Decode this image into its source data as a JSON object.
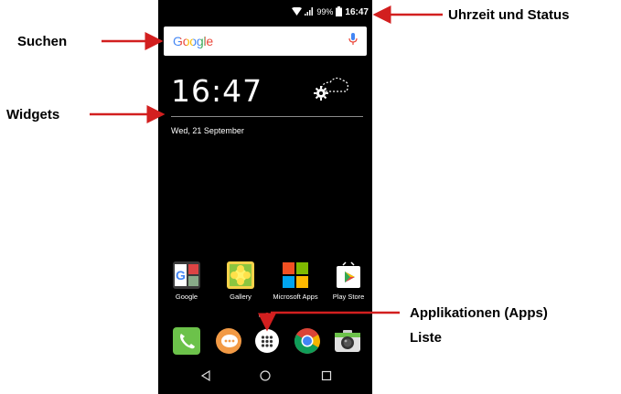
{
  "status": {
    "battery": "99%",
    "time": "16:47"
  },
  "search": {
    "brand": "Google"
  },
  "widget": {
    "clock": "16:47",
    "date": "Wed, 21 September"
  },
  "apps": [
    {
      "label": "Google"
    },
    {
      "label": "Gallery"
    },
    {
      "label": "Microsoft Apps"
    },
    {
      "label": "Play Store"
    }
  ],
  "labels": {
    "status": "Uhrzeit und Status",
    "search": "Suchen",
    "widgets": "Widgets",
    "apps_line1": "Applikationen (Apps)",
    "apps_line2": "Liste"
  },
  "colors": {
    "arrow": "#d21f1f",
    "phone_bg": "#000000"
  },
  "icons": [
    "wifi-icon",
    "signal-icon",
    "battery-icon",
    "mic-icon",
    "weather-icon",
    "phone-icon",
    "messages-icon",
    "app-drawer-icon",
    "chrome-icon",
    "camera-icon",
    "back-icon",
    "home-icon",
    "recents-icon"
  ]
}
